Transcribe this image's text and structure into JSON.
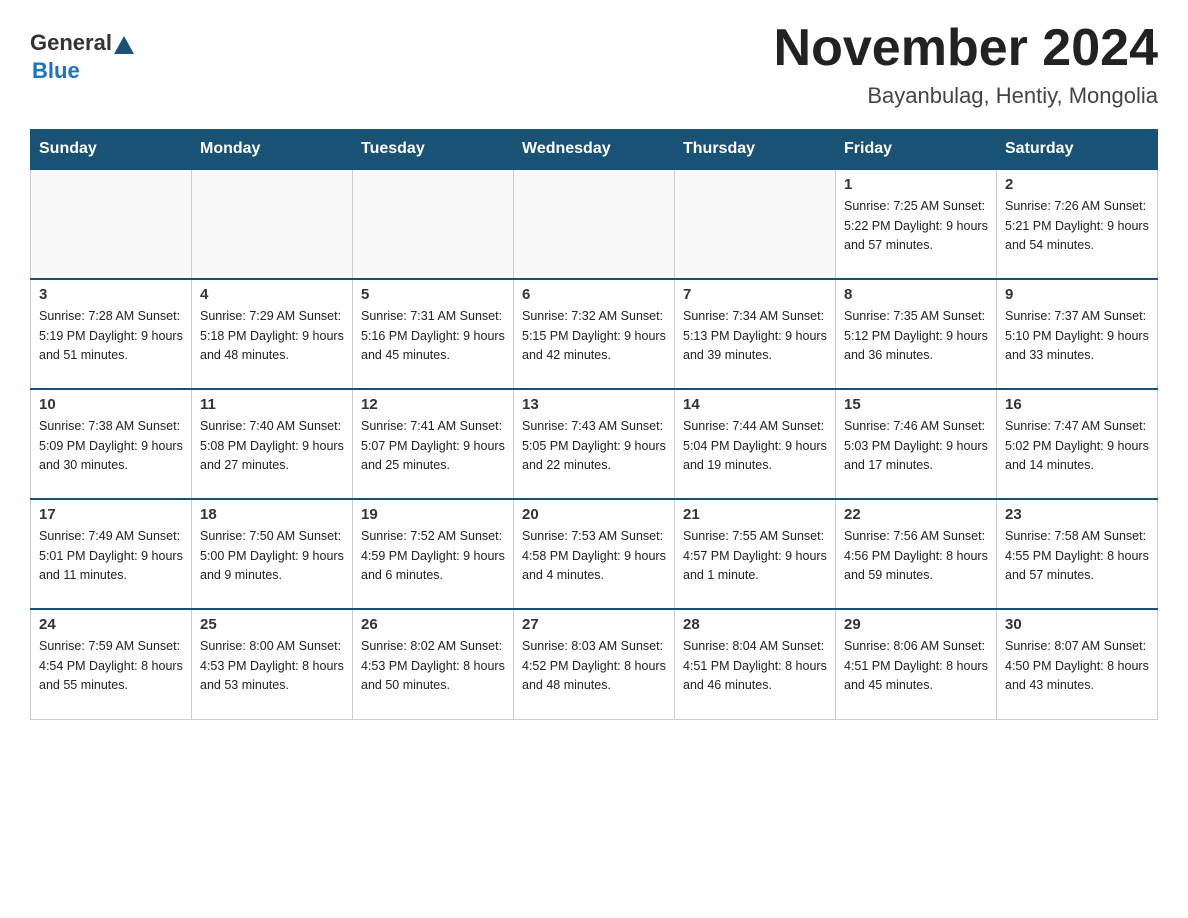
{
  "header": {
    "logo_general": "General",
    "logo_blue": "Blue",
    "title": "November 2024",
    "subtitle": "Bayanbulag, Hentiy, Mongolia"
  },
  "weekdays": [
    "Sunday",
    "Monday",
    "Tuesday",
    "Wednesday",
    "Thursday",
    "Friday",
    "Saturday"
  ],
  "weeks": [
    [
      {
        "day": "",
        "info": ""
      },
      {
        "day": "",
        "info": ""
      },
      {
        "day": "",
        "info": ""
      },
      {
        "day": "",
        "info": ""
      },
      {
        "day": "",
        "info": ""
      },
      {
        "day": "1",
        "info": "Sunrise: 7:25 AM\nSunset: 5:22 PM\nDaylight: 9 hours and 57 minutes."
      },
      {
        "day": "2",
        "info": "Sunrise: 7:26 AM\nSunset: 5:21 PM\nDaylight: 9 hours and 54 minutes."
      }
    ],
    [
      {
        "day": "3",
        "info": "Sunrise: 7:28 AM\nSunset: 5:19 PM\nDaylight: 9 hours and 51 minutes."
      },
      {
        "day": "4",
        "info": "Sunrise: 7:29 AM\nSunset: 5:18 PM\nDaylight: 9 hours and 48 minutes."
      },
      {
        "day": "5",
        "info": "Sunrise: 7:31 AM\nSunset: 5:16 PM\nDaylight: 9 hours and 45 minutes."
      },
      {
        "day": "6",
        "info": "Sunrise: 7:32 AM\nSunset: 5:15 PM\nDaylight: 9 hours and 42 minutes."
      },
      {
        "day": "7",
        "info": "Sunrise: 7:34 AM\nSunset: 5:13 PM\nDaylight: 9 hours and 39 minutes."
      },
      {
        "day": "8",
        "info": "Sunrise: 7:35 AM\nSunset: 5:12 PM\nDaylight: 9 hours and 36 minutes."
      },
      {
        "day": "9",
        "info": "Sunrise: 7:37 AM\nSunset: 5:10 PM\nDaylight: 9 hours and 33 minutes."
      }
    ],
    [
      {
        "day": "10",
        "info": "Sunrise: 7:38 AM\nSunset: 5:09 PM\nDaylight: 9 hours and 30 minutes."
      },
      {
        "day": "11",
        "info": "Sunrise: 7:40 AM\nSunset: 5:08 PM\nDaylight: 9 hours and 27 minutes."
      },
      {
        "day": "12",
        "info": "Sunrise: 7:41 AM\nSunset: 5:07 PM\nDaylight: 9 hours and 25 minutes."
      },
      {
        "day": "13",
        "info": "Sunrise: 7:43 AM\nSunset: 5:05 PM\nDaylight: 9 hours and 22 minutes."
      },
      {
        "day": "14",
        "info": "Sunrise: 7:44 AM\nSunset: 5:04 PM\nDaylight: 9 hours and 19 minutes."
      },
      {
        "day": "15",
        "info": "Sunrise: 7:46 AM\nSunset: 5:03 PM\nDaylight: 9 hours and 17 minutes."
      },
      {
        "day": "16",
        "info": "Sunrise: 7:47 AM\nSunset: 5:02 PM\nDaylight: 9 hours and 14 minutes."
      }
    ],
    [
      {
        "day": "17",
        "info": "Sunrise: 7:49 AM\nSunset: 5:01 PM\nDaylight: 9 hours and 11 minutes."
      },
      {
        "day": "18",
        "info": "Sunrise: 7:50 AM\nSunset: 5:00 PM\nDaylight: 9 hours and 9 minutes."
      },
      {
        "day": "19",
        "info": "Sunrise: 7:52 AM\nSunset: 4:59 PM\nDaylight: 9 hours and 6 minutes."
      },
      {
        "day": "20",
        "info": "Sunrise: 7:53 AM\nSunset: 4:58 PM\nDaylight: 9 hours and 4 minutes."
      },
      {
        "day": "21",
        "info": "Sunrise: 7:55 AM\nSunset: 4:57 PM\nDaylight: 9 hours and 1 minute."
      },
      {
        "day": "22",
        "info": "Sunrise: 7:56 AM\nSunset: 4:56 PM\nDaylight: 8 hours and 59 minutes."
      },
      {
        "day": "23",
        "info": "Sunrise: 7:58 AM\nSunset: 4:55 PM\nDaylight: 8 hours and 57 minutes."
      }
    ],
    [
      {
        "day": "24",
        "info": "Sunrise: 7:59 AM\nSunset: 4:54 PM\nDaylight: 8 hours and 55 minutes."
      },
      {
        "day": "25",
        "info": "Sunrise: 8:00 AM\nSunset: 4:53 PM\nDaylight: 8 hours and 53 minutes."
      },
      {
        "day": "26",
        "info": "Sunrise: 8:02 AM\nSunset: 4:53 PM\nDaylight: 8 hours and 50 minutes."
      },
      {
        "day": "27",
        "info": "Sunrise: 8:03 AM\nSunset: 4:52 PM\nDaylight: 8 hours and 48 minutes."
      },
      {
        "day": "28",
        "info": "Sunrise: 8:04 AM\nSunset: 4:51 PM\nDaylight: 8 hours and 46 minutes."
      },
      {
        "day": "29",
        "info": "Sunrise: 8:06 AM\nSunset: 4:51 PM\nDaylight: 8 hours and 45 minutes."
      },
      {
        "day": "30",
        "info": "Sunrise: 8:07 AM\nSunset: 4:50 PM\nDaylight: 8 hours and 43 minutes."
      }
    ]
  ]
}
